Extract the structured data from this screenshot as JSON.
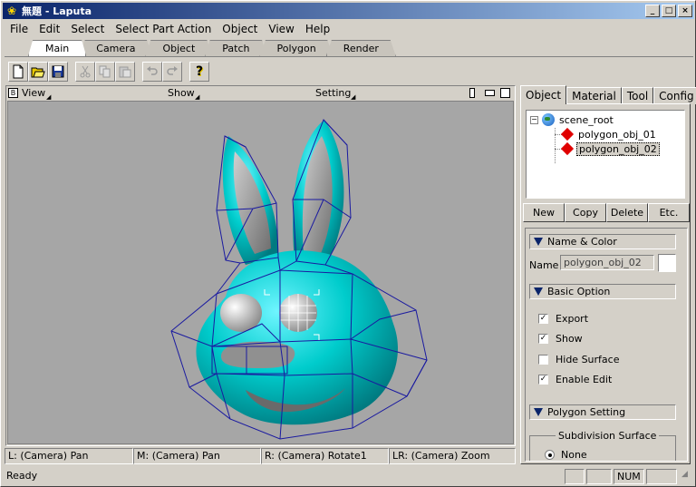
{
  "window": {
    "title": "無題 - Laputa",
    "minimize": "_",
    "maximize": "□",
    "close": "×"
  },
  "menu": [
    {
      "label": "File"
    },
    {
      "label": "Edit"
    },
    {
      "label": "Select"
    },
    {
      "label": "Select Part Action"
    },
    {
      "label": "Object"
    },
    {
      "label": "View"
    },
    {
      "label": "Help"
    }
  ],
  "mode_tabs": [
    "Main",
    "Camera",
    "Object",
    "Patch",
    "Polygon",
    "Render"
  ],
  "active_mode_tab": "Main",
  "toolbar": {
    "icons": [
      "new-file-icon",
      "open-folder-icon",
      "save-icon",
      "cut-icon",
      "copy-icon",
      "paste-icon",
      "undo-icon",
      "redo-icon",
      "help-icon"
    ],
    "help_glyph": "?"
  },
  "viewport": {
    "corner_label": "B",
    "view_label": "View",
    "show_label": "Show",
    "setting_label": "Setting"
  },
  "hints": [
    "L: (Camera) Pan",
    "M: (Camera) Pan",
    "R: (Camera) Rotate1",
    "LR: (Camera) Zoom"
  ],
  "status": {
    "text": "Ready",
    "num": "NUM"
  },
  "panel": {
    "tabs": [
      "Object",
      "Material",
      "Tool",
      "Config"
    ],
    "active_tab": "Object",
    "tree": {
      "root": "scene_root",
      "expander": "−",
      "children": [
        "polygon_obj_01",
        "polygon_obj_02"
      ],
      "selected": "polygon_obj_02"
    },
    "buttons": [
      "New",
      "Copy",
      "Delete",
      "Etc."
    ],
    "sections": {
      "name_color": "Name & Color",
      "basic_option": "Basic Option",
      "polygon_setting": "Polygon Setting"
    },
    "name_label": "Name",
    "name_value": "polygon_obj_02",
    "options": [
      {
        "label": "Export",
        "checked": true
      },
      {
        "label": "Show",
        "checked": true
      },
      {
        "label": "Hide Surface",
        "checked": false
      },
      {
        "label": "Enable Edit",
        "checked": true
      }
    ],
    "check_glyph": "✓",
    "subdivision": {
      "title": "Subdivision Surface",
      "selected_option": "None"
    }
  },
  "colors": {
    "titlebar_start": "#0a246a",
    "titlebar_end": "#a6caf0",
    "model": "#00cccc",
    "wireframe": "#1a1aa0",
    "viewport_bg": "#a6a6a6"
  }
}
